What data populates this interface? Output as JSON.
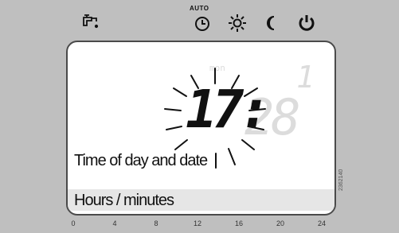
{
  "auto_label": "AUTO",
  "icons": [
    "tap-icon",
    "clock-auto-icon",
    "sun-icon",
    "moon-icon",
    "power-icon"
  ],
  "display": {
    "time_digits": "17:",
    "ghost_digits": "28",
    "ghost_one": "1",
    "ghost_mon": "mon",
    "label": "Time of day and date",
    "hours_label": "Hours / minutes"
  },
  "timeline": [
    "0",
    "4",
    "8",
    "12",
    "16",
    "20",
    "24"
  ],
  "side_code": "2362140",
  "colors": {
    "background": "#bfbfbf",
    "screen": "#ffffff",
    "highlight": "#e6e6e6"
  }
}
